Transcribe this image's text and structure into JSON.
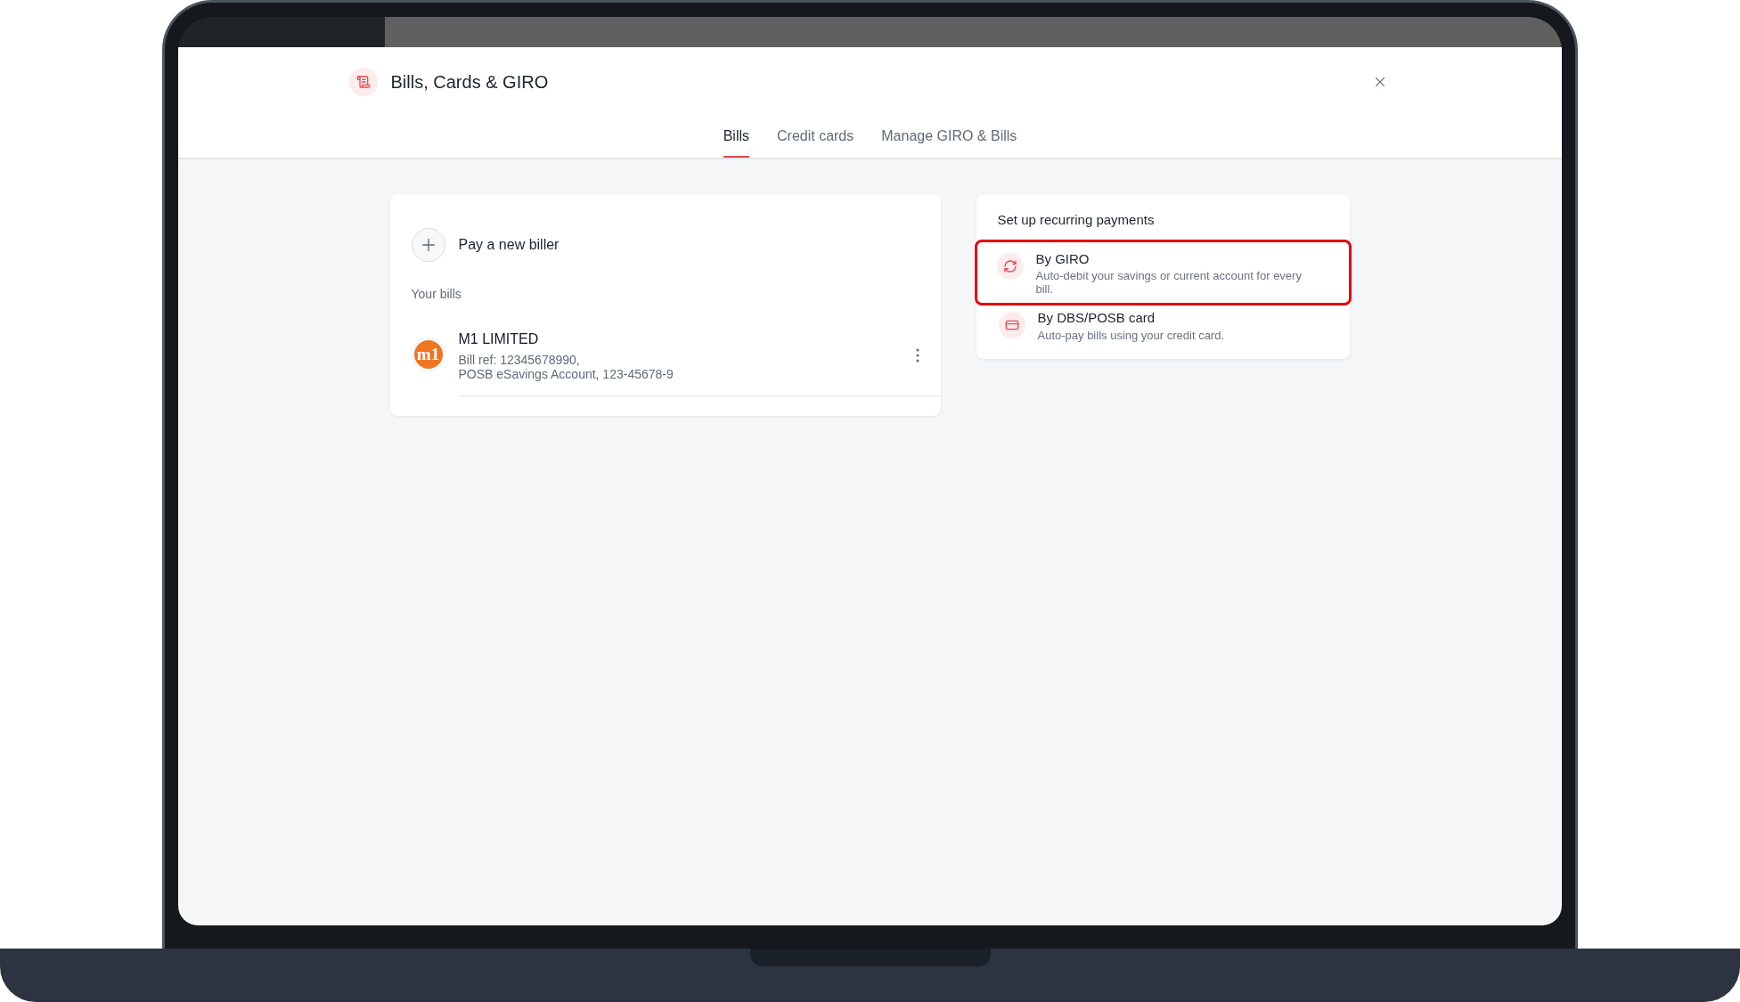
{
  "modal": {
    "title": "Bills, Cards & GIRO",
    "tabs": [
      {
        "label": "Bills",
        "selected": true
      },
      {
        "label": "Credit cards",
        "selected": false
      },
      {
        "label": "Manage GIRO & Bills",
        "selected": false
      }
    ]
  },
  "bills_card": {
    "new_biller": "Pay a new biller",
    "section_label": "Your bills",
    "bills": [
      {
        "logo_text": "m1",
        "name": "M1 LIMITED",
        "ref": "Bill ref: 12345678990,",
        "account": "POSB eSavings Account, 123-45678-9"
      }
    ]
  },
  "recurring": {
    "title": "Set up recurring payments",
    "options": [
      {
        "kind": "giro",
        "title": "By GIRO",
        "description": "Auto-debit your savings or current account for every bill.",
        "highlighted": true
      },
      {
        "kind": "card",
        "title": "By DBS/POSB card",
        "description": "Auto-pay bills using your credit card.",
        "highlighted": false
      }
    ]
  }
}
